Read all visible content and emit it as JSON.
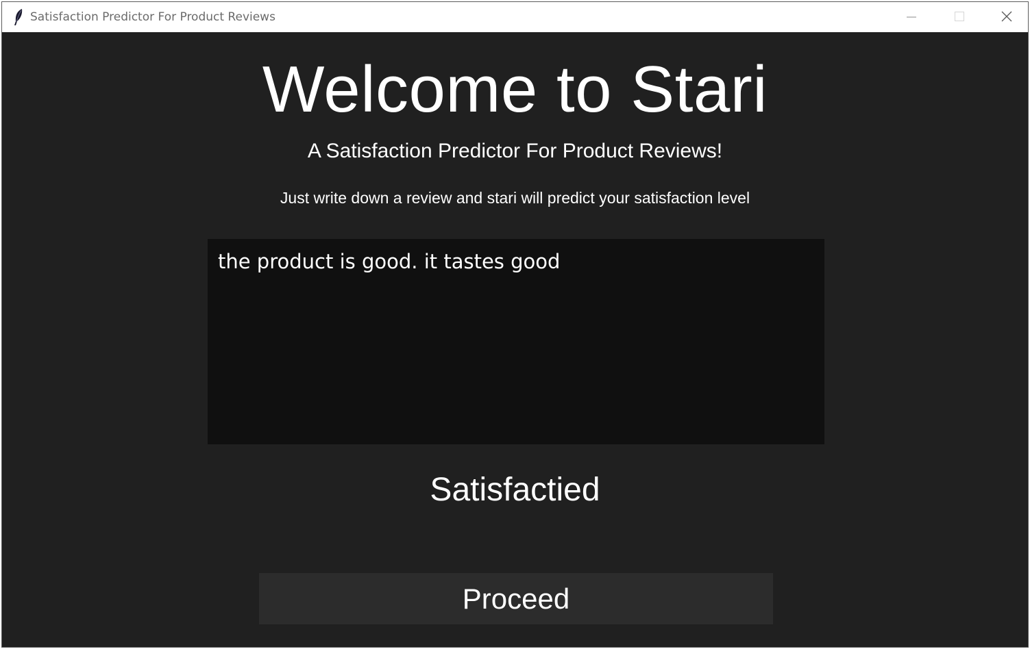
{
  "window": {
    "title": "Satisfaction Predictor For Product Reviews"
  },
  "main": {
    "heading": "Welcome to Stari",
    "subtitle": "A Satisfaction Predictor For Product Reviews!",
    "instruction": "Just write down a review and stari will predict your satisfaction level",
    "review_text": "the product is good. it tastes good",
    "prediction": "Satisfactied",
    "proceed_label": "Proceed"
  },
  "icons": {
    "app": "feather-icon",
    "minimize": "minimize-icon",
    "maximize": "maximize-icon",
    "close": "close-icon"
  },
  "colors": {
    "background": "#202020",
    "textbox": "#101010",
    "button": "#2c2c2c",
    "text": "#ffffff",
    "titlebar": "#ffffff"
  }
}
